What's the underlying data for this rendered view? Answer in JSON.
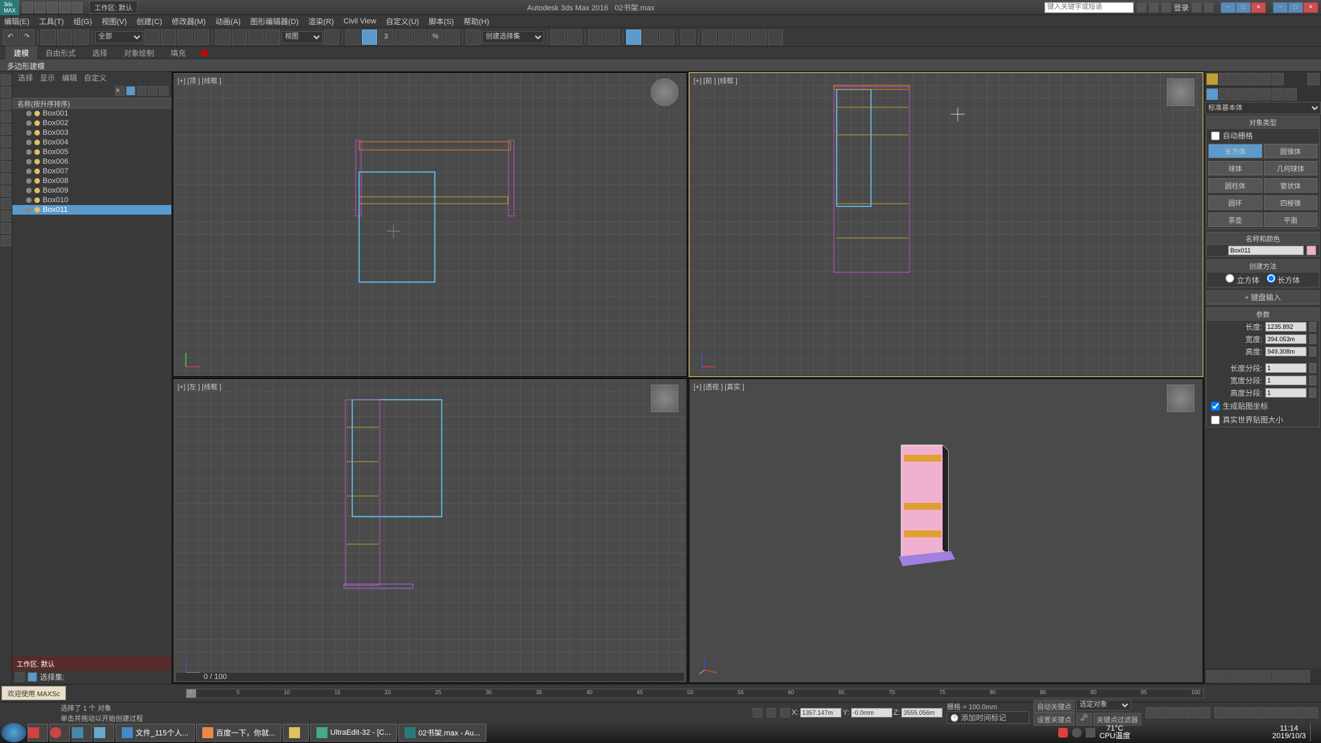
{
  "titlebar": {
    "app": "Autodesk 3ds Max 2016",
    "file": "02书架.max",
    "workspace_label": "工作区: 默认",
    "search_placeholder": "键入关键字或短语",
    "login": "登录"
  },
  "menubar": [
    "编辑(E)",
    "工具(T)",
    "组(G)",
    "视图(V)",
    "创建(C)",
    "修改器(M)",
    "动画(A)",
    "图形编辑器(D)",
    "渲染(R)",
    "Civil View",
    "自定义(U)",
    "脚本(S)",
    "帮助(H)"
  ],
  "toolbar": {
    "scope": "全部",
    "view": "视图",
    "selectset": "创建选择集"
  },
  "ribbon": {
    "tabs": [
      "建模",
      "自由形式",
      "选择",
      "对象绘制",
      "填充"
    ],
    "active": 0,
    "sub": "多边形建模"
  },
  "scene": {
    "tabs": [
      "选择",
      "显示",
      "编辑",
      "自定义"
    ],
    "header": "名称(按升序排序)",
    "items": [
      {
        "name": "Box001"
      },
      {
        "name": "Box002"
      },
      {
        "name": "Box003"
      },
      {
        "name": "Box004"
      },
      {
        "name": "Box005"
      },
      {
        "name": "Box006"
      },
      {
        "name": "Box007"
      },
      {
        "name": "Box008"
      },
      {
        "name": "Box009"
      },
      {
        "name": "Box010"
      },
      {
        "name": "Box011",
        "selected": true
      }
    ],
    "footer": "工作区: 默认",
    "selset_label": "选择集:"
  },
  "viewports": {
    "top": "[+] [顶 ] [线框 ]",
    "front": "[+] [前 ] [线框 ]",
    "left": "[+] [左 ] [线框 ]",
    "persp": "[+] [透视 ] [真实 ]",
    "slider": "0 / 100"
  },
  "rpanel": {
    "category": "标准基本体",
    "sect_objtype": "对象类型",
    "autogrid": "自动栅格",
    "prims": [
      [
        "长方体",
        "圆锥体"
      ],
      [
        "球体",
        "几何球体"
      ],
      [
        "圆柱体",
        "管状体"
      ],
      [
        "圆环",
        "四棱锥"
      ],
      [
        "茶壶",
        "平面"
      ]
    ],
    "sect_namecolor": "名称和颜色",
    "objname": "Box011",
    "sect_create": "创建方法",
    "create_opts": [
      "立方体",
      "长方体"
    ],
    "sect_kb": "键盘输入",
    "sect_params": "参数",
    "params": [
      {
        "label": "长度:",
        "value": "1235.892"
      },
      {
        "label": "宽度:",
        "value": "394.053m"
      },
      {
        "label": "高度:",
        "value": "949.308m"
      },
      {
        "label": "长度分段:",
        "value": "1"
      },
      {
        "label": "宽度分段:",
        "value": "1"
      },
      {
        "label": "高度分段:",
        "value": "1"
      }
    ],
    "gen_uv": "生成贴图坐标",
    "real_world": "真实世界贴图大小"
  },
  "status": {
    "sel": "选择了 1 个 对象",
    "hint": "单击并拖动以开始创建过程",
    "welcome": "欢迎使用 MAXSc",
    "x": "1357.147m",
    "y": "-0.0mm",
    "z": "3555.056m",
    "grid": "栅格 = 100.0mm",
    "autokey": "自动关键点",
    "setkey": "设置关键点",
    "selobj": "选定对象",
    "keyfilter": "关键点过滤器",
    "addtime": "添加时间标记"
  },
  "timeline": {
    "ticks": [
      "0",
      "5",
      "10",
      "15",
      "20",
      "25",
      "30",
      "35",
      "40",
      "45",
      "50",
      "55",
      "60",
      "65",
      "70",
      "75",
      "80",
      "85",
      "90",
      "95",
      "100"
    ]
  },
  "taskbar": {
    "tasks": [
      {
        "label": "文件_115个人..."
      },
      {
        "label": "百度一下，你就..."
      },
      {
        "label": ""
      },
      {
        "label": "UltraEdit-32 - [C..."
      },
      {
        "label": "02书架.max - Au..."
      }
    ],
    "temp": "71°C",
    "temp_label": "CPU温度",
    "time": "11:14",
    "date": "2019/10/3"
  }
}
